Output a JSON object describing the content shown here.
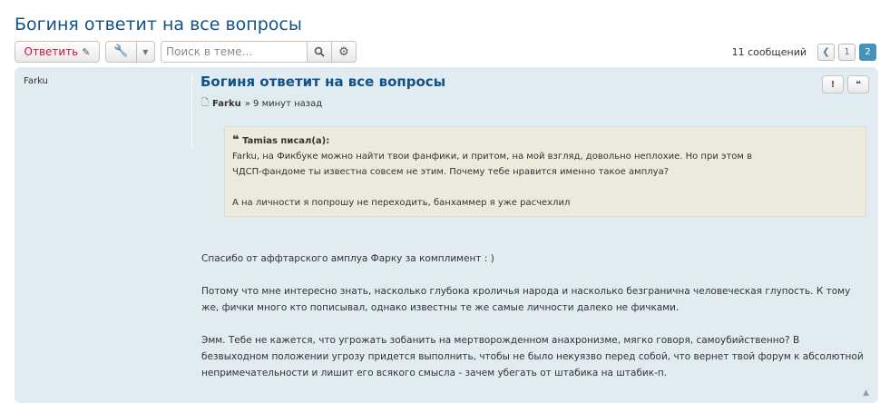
{
  "topic": {
    "title": "Богиня ответит на все вопросы"
  },
  "toolbar": {
    "reply_label": "Ответить",
    "search_placeholder": "Поиск в теме…"
  },
  "pagination": {
    "count_text": "11 сообщений",
    "pages": [
      "1",
      "2"
    ],
    "current": "2"
  },
  "post": {
    "author": "Farku",
    "title": "Богиня ответит на все вопросы",
    "meta_author": "Farku",
    "meta_time": "» 9 минут назад",
    "quote": {
      "header": "Tamias писал(а):",
      "lines": [
        "Farku, на Фикбуке можно найти твои фанфики, и притом, на мой взгляд, довольно неплохие. Но при этом в",
        "ЧДСП-фандоме ты известна совсем не этим. Почему тебе нравится именно такое амплуа?",
        "А на личности я попрошу не переходить, банхаммер я уже расчехлил"
      ]
    },
    "paragraphs": [
      "Спасибо от аффтарского амплуа Фарку за комплимент : )",
      "Потому что мне интересно знать, насколько глубока кроличья народа и насколько безгранична человеческая глупость. К тому же, фички много кто пописывал, однако известны те же самые личности далеко не фичками.",
      "Эмм. Тебе не кажется, что угрожать зобанить на мертворожденном анахронизме, мягко говоря, самоубийственно? В безвыходном положении угрозу придется выполнить, чтобы не было некуязво перед собой, что вернет твой форум к абсолютной непримечательности и лишит его всякого смысла - зачем убегать от штабика на штабик-п."
    ]
  }
}
